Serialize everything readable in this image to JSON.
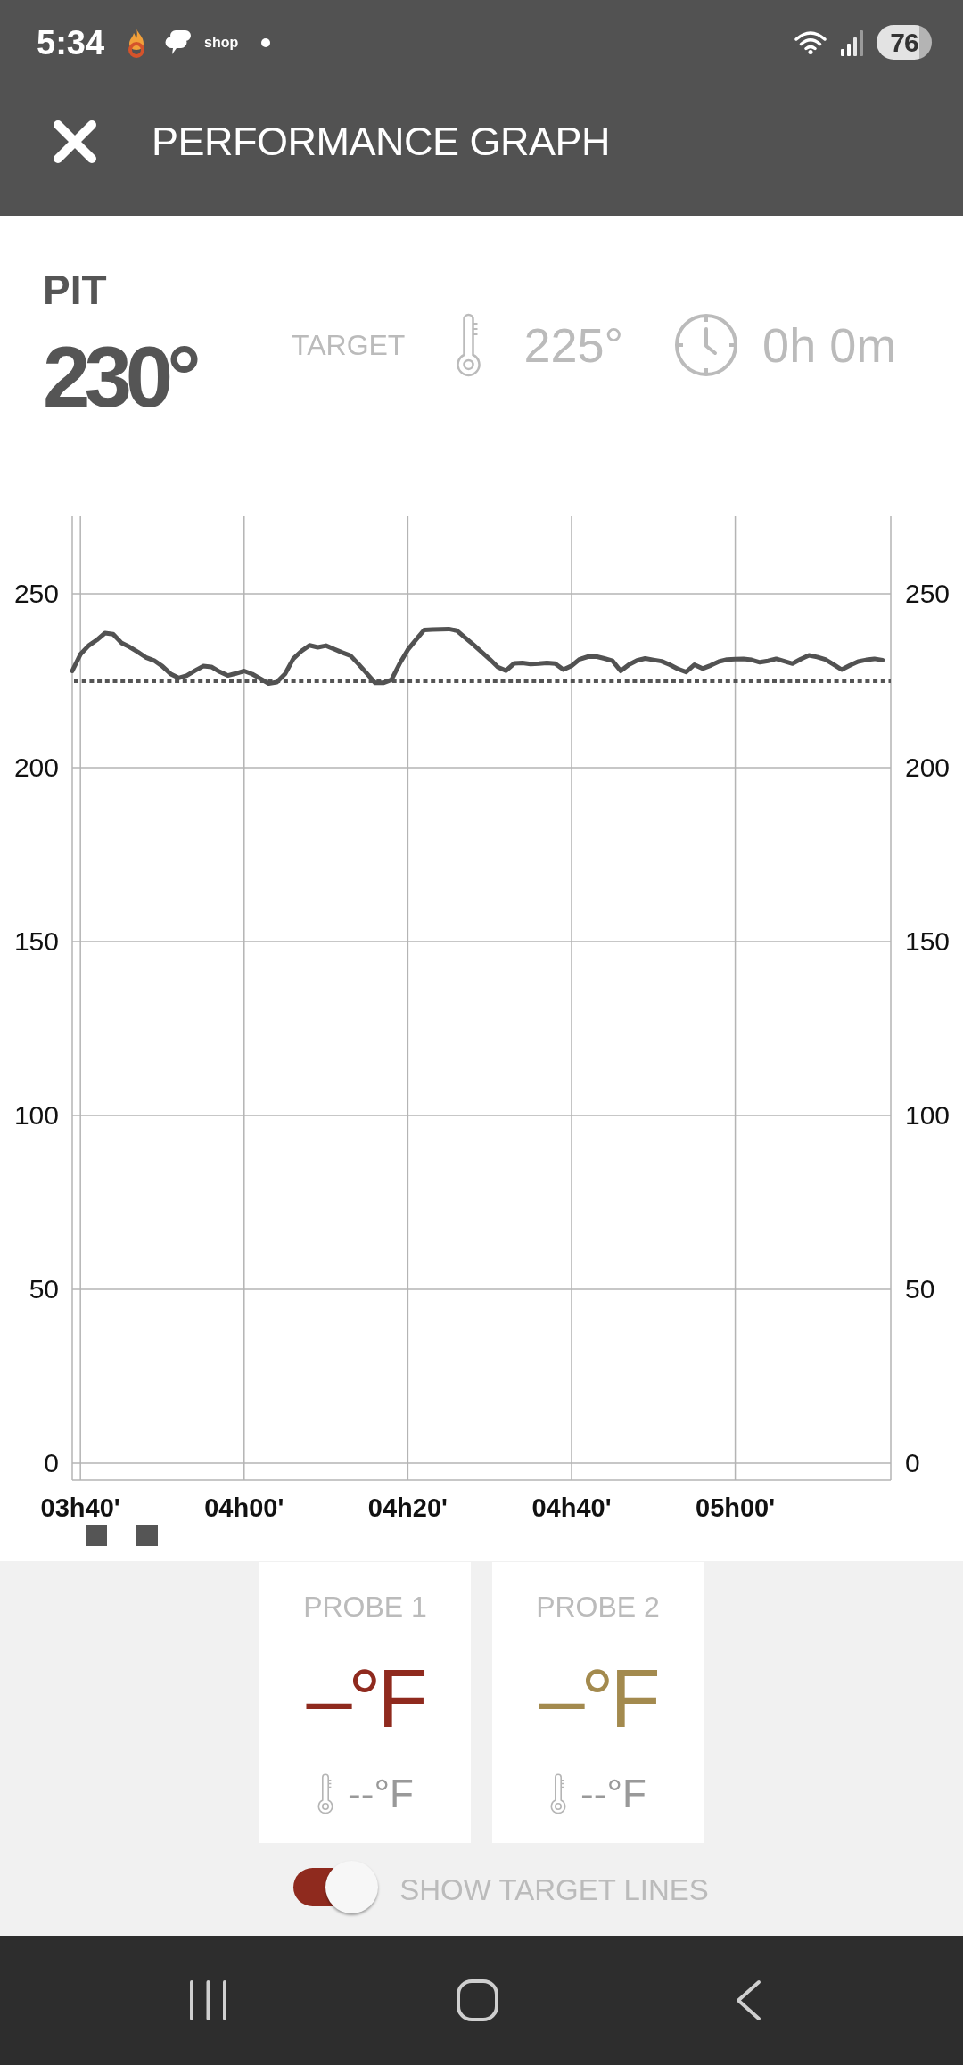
{
  "status_bar": {
    "time": "5:34",
    "app_label": "shop",
    "battery": "76"
  },
  "toolbar": {
    "title": "PERFORMANCE GRAPH"
  },
  "pit": {
    "label": "PIT",
    "temperature": "230°",
    "target_label": "TARGET",
    "target": "225°",
    "timer": "0h 0m"
  },
  "chart": {
    "chart_data": {
      "type": "line",
      "grid": true,
      "categories": [
        null,
        "03h40'",
        null,
        null,
        null,
        null,
        null,
        null,
        null,
        null,
        null,
        null,
        null,
        null,
        null,
        null,
        null,
        null,
        null,
        null,
        null,
        "04h00'",
        null,
        null,
        null,
        null,
        null,
        null,
        null,
        null,
        null,
        null,
        null,
        null,
        null,
        null,
        null,
        null,
        null,
        null,
        null,
        "04h20'",
        null,
        null,
        null,
        null,
        null,
        null,
        null,
        null,
        null,
        null,
        null,
        null,
        null,
        null,
        null,
        null,
        null,
        null,
        null,
        "04h40'",
        null,
        null,
        null,
        null,
        null,
        null,
        null,
        null,
        null,
        null,
        null,
        null,
        null,
        null,
        null,
        null,
        null,
        null,
        null,
        "05h00'",
        null,
        null,
        null,
        null,
        null,
        null,
        null,
        null,
        null,
        null,
        null,
        null,
        null,
        null,
        null,
        null,
        null,
        null
      ],
      "series": [
        {
          "color": "#525252",
          "values": [
            227.8,
            232.6,
            235.1,
            236.7,
            238.7,
            238.4,
            235.9,
            234.7,
            233.3,
            231.7,
            230.8,
            229.2,
            227.0,
            225.8,
            226.5,
            227.9,
            229.2,
            229.0,
            227.6,
            226.5,
            227.1,
            227.8,
            226.9,
            225.6,
            224.2,
            224.6,
            227.0,
            231.3,
            233.5,
            235.2,
            234.6,
            235.1,
            234.1,
            233.1,
            232.2,
            229.7,
            227.1,
            224.4,
            224.4,
            225.3,
            229.9,
            233.9,
            236.8,
            239.6,
            239.7,
            239.8,
            239.9,
            239.4,
            237.4,
            235.4,
            233.3,
            231.2,
            228.9,
            227.9,
            230.0,
            230.1,
            229.8,
            229.9,
            230.1,
            229.9,
            228.2,
            229.3,
            231.2,
            231.9,
            232.0,
            231.4,
            230.7,
            227.8,
            229.6,
            230.8,
            231.4,
            231.0,
            230.6,
            229.6,
            228.4,
            227.5,
            229.6,
            228.5,
            229.4,
            230.5,
            231.1,
            231.2,
            231.3,
            231.0,
            230.3,
            230.7,
            231.3,
            230.6,
            229.9,
            231.2,
            232.3,
            231.8,
            231.1,
            229.7,
            228.2,
            229.4,
            230.5,
            231.0,
            231.3,
            230.9
          ]
        }
      ],
      "ylim": [
        -4.9,
        272.3
      ],
      "yticks": [
        0,
        50,
        100,
        150,
        200,
        250
      ],
      "ref_lines": [
        {
          "axis": "y",
          "value": 225
        }
      ]
    },
    "right_axis_labels": [
      "250",
      "200",
      "150",
      "100",
      "50",
      "0"
    ]
  },
  "probes": [
    {
      "label": "PROBE 1",
      "temperature": "–°F",
      "target": "--°F",
      "color": "#8f2a1e"
    },
    {
      "label": "PROBE 2",
      "temperature": "–°F",
      "target": "--°F",
      "color": "#a38a4e"
    }
  ],
  "show_target_lines": {
    "label": "SHOW TARGET LINES",
    "on": true
  }
}
